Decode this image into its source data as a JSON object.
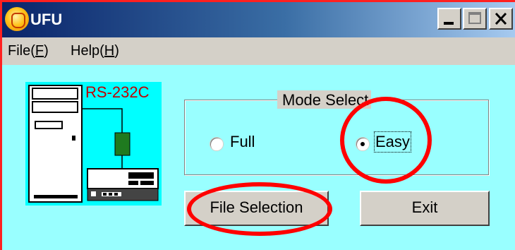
{
  "window": {
    "title": "UFU"
  },
  "title_buttons": {
    "minimize": "minimize-icon",
    "maximize": "maximize-icon",
    "close": "close-icon"
  },
  "menu": {
    "file": {
      "label": "File(",
      "accel": "F",
      "close": ")"
    },
    "help": {
      "label": "Help(",
      "accel": "H",
      "close": ")"
    }
  },
  "illustration": {
    "label": "RS-232C"
  },
  "mode_select": {
    "title": "Mode Select",
    "options": [
      {
        "label": "Full",
        "selected": false
      },
      {
        "label": "Easy",
        "selected": true
      }
    ]
  },
  "buttons": {
    "file_selection": "File Selection",
    "exit": "Exit"
  },
  "colors": {
    "client_bg": "#99ffff",
    "annotation_ring": "#ff0000",
    "rs_label": "#c00000",
    "device_green": "#1f7a1f"
  }
}
